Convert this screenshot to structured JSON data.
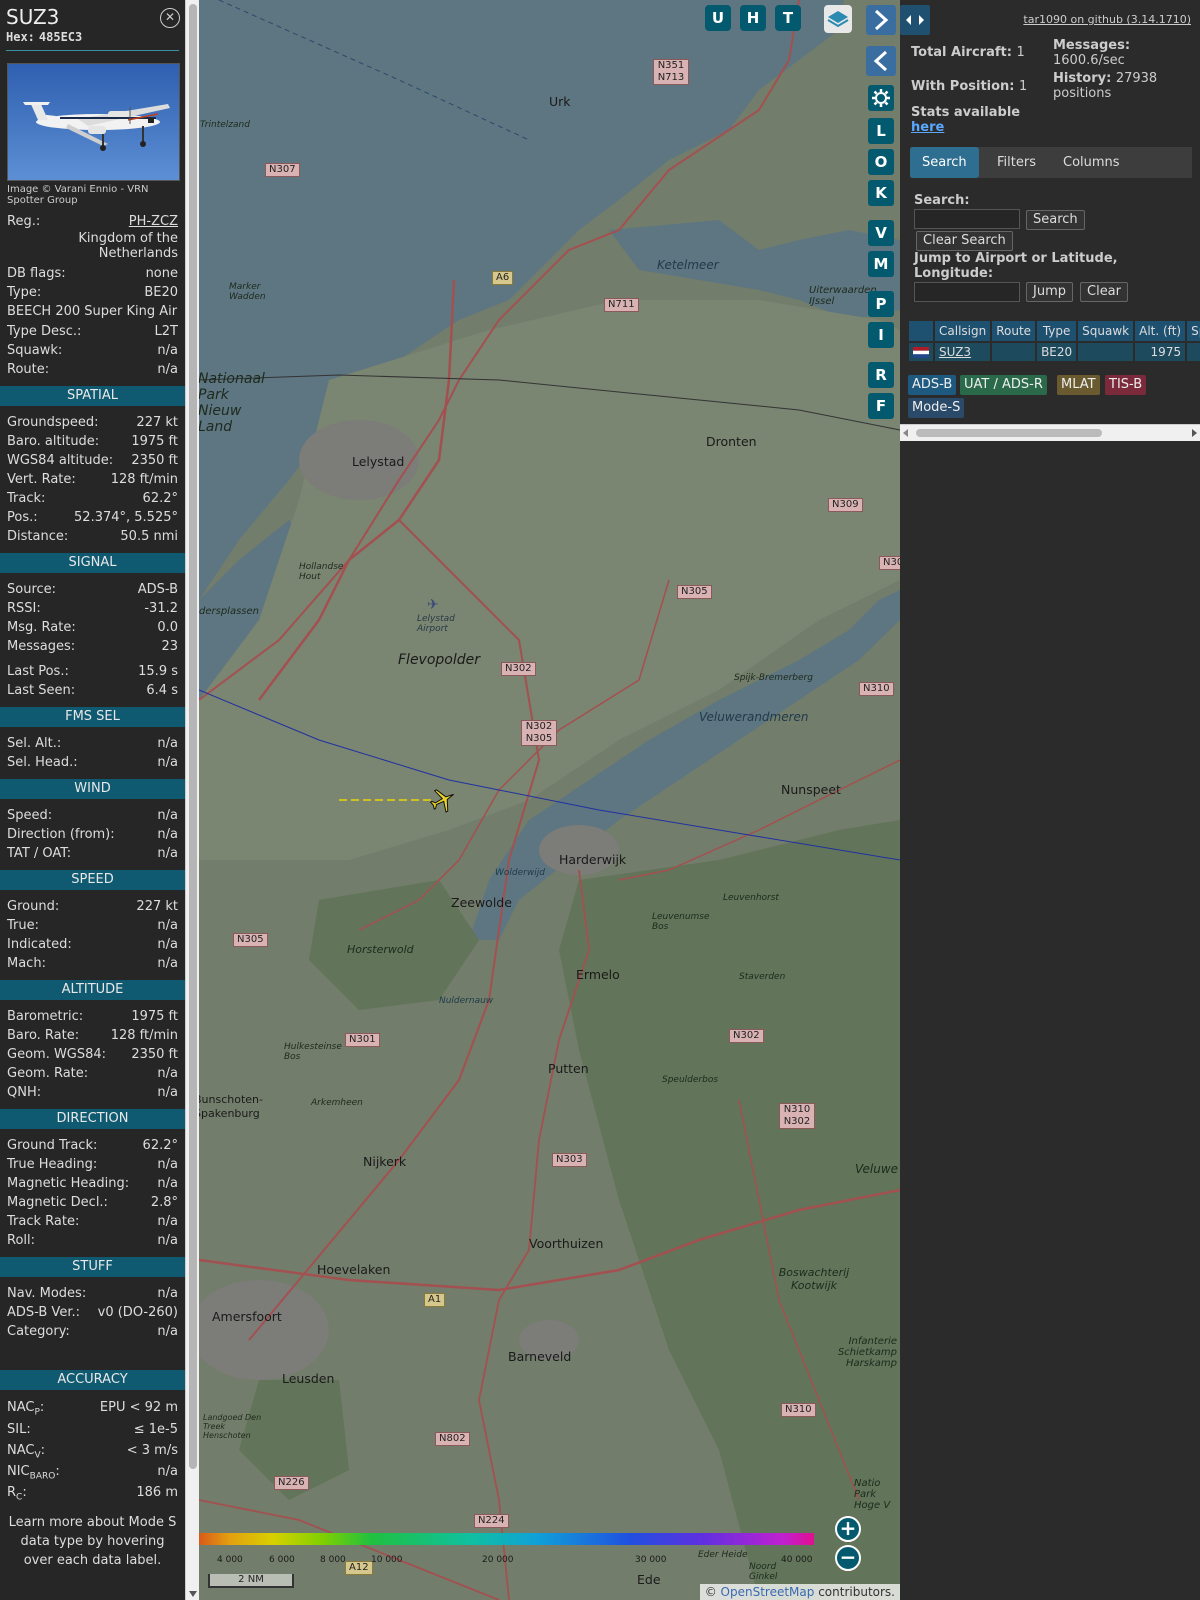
{
  "sidebar": {
    "callsign": "SUZ3",
    "hex_label": "Hex:",
    "hex": "485EC3",
    "photo_credit": "Image © Varani Ennio - VRN Spotter Group",
    "reg_label": "Reg.:",
    "reg": "PH-ZCZ",
    "country": "Kingdom of the Netherlands",
    "dbflags_label": "DB flags:",
    "dbflags": "none",
    "type_label": "Type:",
    "type": "BE20",
    "type_full": "BEECH 200 Super King Air",
    "typedesc_label": "Type Desc.:",
    "typedesc": "L2T",
    "squawk_label": "Squawk:",
    "squawk": "n/a",
    "route_label": "Route:",
    "route": "n/a",
    "sections": {
      "spatial": "SPATIAL",
      "signal": "SIGNAL",
      "fms": "FMS SEL",
      "wind": "WIND",
      "speed": "SPEED",
      "altitude": "ALTITUDE",
      "direction": "DIRECTION",
      "stuff": "STUFF",
      "accuracy": "ACCURACY"
    },
    "spatial": [
      {
        "label": "Groundspeed:",
        "value": "227 kt"
      },
      {
        "label": "Baro. altitude:",
        "value": "1975 ft"
      },
      {
        "label": "WGS84 altitude:",
        "value": "2350 ft"
      },
      {
        "label": "Vert. Rate:",
        "value": "128 ft/min"
      },
      {
        "label": "Track:",
        "value": "62.2°"
      },
      {
        "label": "Pos.:",
        "value": "52.374°, 5.525°"
      },
      {
        "label": "Distance:",
        "value": "50.5 nmi"
      }
    ],
    "signal": [
      {
        "label": "Source:",
        "value": "ADS-B"
      },
      {
        "label": "RSSI:",
        "value": "-31.2"
      },
      {
        "label": "Msg. Rate:",
        "value": "0.0"
      },
      {
        "label": "Messages:",
        "value": "23"
      }
    ],
    "signal2": [
      {
        "label": "Last Pos.:",
        "value": "15.9 s"
      },
      {
        "label": "Last Seen:",
        "value": "6.4 s"
      }
    ],
    "fms": [
      {
        "label": "Sel. Alt.:",
        "value": "n/a"
      },
      {
        "label": "Sel. Head.:",
        "value": "n/a"
      }
    ],
    "wind": [
      {
        "label": "Speed:",
        "value": "n/a"
      },
      {
        "label": "Direction (from):",
        "value": "n/a"
      },
      {
        "label": "TAT / OAT:",
        "value": "n/a"
      }
    ],
    "speed": [
      {
        "label": "Ground:",
        "value": "227 kt"
      },
      {
        "label": "True:",
        "value": "n/a"
      },
      {
        "label": "Indicated:",
        "value": "n/a"
      },
      {
        "label": "Mach:",
        "value": "n/a"
      }
    ],
    "altitude": [
      {
        "label": "Barometric:",
        "value": "1975 ft"
      },
      {
        "label": "Baro. Rate:",
        "value": "128 ft/min"
      },
      {
        "label": "Geom. WGS84:",
        "value": "2350 ft"
      },
      {
        "label": "Geom. Rate:",
        "value": "n/a"
      },
      {
        "label": "QNH:",
        "value": "n/a"
      }
    ],
    "direction": [
      {
        "label": "Ground Track:",
        "value": "62.2°"
      },
      {
        "label": "True Heading:",
        "value": "n/a"
      },
      {
        "label": "Magnetic Heading:",
        "value": "n/a"
      },
      {
        "label": "Magnetic Decl.:",
        "value": "2.8°"
      },
      {
        "label": "Track Rate:",
        "value": "n/a"
      },
      {
        "label": "Roll:",
        "value": "n/a"
      }
    ],
    "stuff": [
      {
        "label": "Nav. Modes:",
        "value": "n/a"
      },
      {
        "label": "ADS-B Ver.:",
        "value": "v0 (DO-260)"
      },
      {
        "label": "Category:",
        "value": "n/a"
      }
    ],
    "accuracy": {
      "nacp_base": "NAC",
      "nacp_sub": "P",
      "nacp_value": "EPU < 92 m",
      "sil_label": "SIL:",
      "sil_value": "≤ 1e-5",
      "nacv_base": "NAC",
      "nacv_sub": "V",
      "nacv_value": "< 3 m/s",
      "nic_base": "NIC",
      "nic_sub": "BARO",
      "nic_value": "n/a",
      "rc_base": "R",
      "rc_sub": "C",
      "rc_value": "186 m"
    },
    "footer": "Learn more about Mode S data type by hovering over each data label."
  },
  "map": {
    "buttons_top": [
      "U",
      "H",
      "T"
    ],
    "buttons_side": [
      "L",
      "O",
      "K",
      "V",
      "M",
      "P",
      "I",
      "R",
      "F"
    ],
    "labels": {
      "urk": "Urk",
      "lelystad": "Lelystad",
      "dronten": "Dronten",
      "flevopolder": "Flevopolder",
      "harderwijk": "Harderwijk",
      "zeewolde": "Zeewolde",
      "ermelo": "Ermelo",
      "putten": "Putten",
      "nijkerk": "Nijkerk",
      "voorthuizen": "Voorthuizen",
      "hoevelaken": "Hoevelaken",
      "amersfoort": "Amersfoort",
      "barneveld": "Barneveld",
      "leusden": "Leusden",
      "ede": "Ede",
      "nunspeet": "Nunspeet",
      "ketelmeer": "Ketelmeer",
      "veluwerandmeren": "Veluwerandmeren",
      "horsterwold": "Horsterwold",
      "markerwadden": "Marker Wadden",
      "trintelzand": "Trintelzand",
      "nationaal": "Nationaal Park Nieuw Land",
      "hollandse": "Hollandse Hout",
      "lelystad_airport": "Lelystad Airport",
      "spijk": "Spijk-Bremerberg",
      "leuvenhorst": "Leuvenhorst",
      "leuvenumse": "Leuvenumse Bos",
      "staverden": "Staverden",
      "speulderbos": "Speulderbos",
      "boswachterij": "Boswachterij Kootwijk",
      "arkemheen": "Arkemheen",
      "bunschoten": "Bunschoten-Spakenburg",
      "hulkesteinse": "Hulkesteinse Bos",
      "uiterwaarden": "Uiterwaarden IJssel",
      "dersplassen": "dersplassen",
      "veluwe": "Veluwe",
      "infanterie": "Infanterie Schietkamp Harskamp",
      "langoed": "Landgoed Den Treek Henschoten",
      "nationaal2": "Natio Park Hoge V",
      "nuldernauw": "Nuldernauw",
      "wolderwijd": "Wolderwijd",
      "eder": "Eder Heide",
      "noord": "Noord Ginkel"
    },
    "roads": [
      "N307",
      "N351 N713",
      "A6",
      "N711",
      "N309",
      "N305",
      "N302",
      "N302 N305",
      "N305",
      "N301",
      "N303",
      "N302",
      "N310 N302",
      "A1",
      "N310",
      "N802",
      "N226",
      "N224",
      "A12",
      "N310",
      "N30"
    ],
    "colorbar_ticks": [
      "4 000",
      "6 000",
      "8 000",
      "10 000",
      "20 000",
      "30 000",
      "40 000"
    ],
    "scale": "2 NM",
    "attribution_prefix": "© ",
    "attribution_link": "OpenStreetMap",
    "attribution_suffix": " contributors."
  },
  "right": {
    "github": "tar1090 on github (3.14.1710)",
    "total_label": "Total Aircraft:",
    "total_value": "1",
    "withpos_label": "With Position:",
    "withpos_value": "1",
    "stats_label": "Stats available",
    "stats_link": "here",
    "messages_label": "Messages:",
    "messages_value": "1600.6/sec",
    "history_label": "History:",
    "history_value": "27938 positions",
    "tabs": [
      "Search",
      "Filters",
      "Columns"
    ],
    "search_label": "Search:",
    "search_btn": "Search",
    "clear_search_btn": "Clear Search",
    "jump_label": "Jump to Airport or Latitude, Longitude:",
    "jump_btn": "Jump",
    "clear_btn": "Clear",
    "table": {
      "headers": [
        "",
        "Callsign",
        "Route",
        "Type",
        "Squawk",
        "Alt. (ft)",
        "Spd."
      ],
      "row": {
        "callsign": "SUZ3",
        "route": "",
        "type": "BE20",
        "squawk": "",
        "alt": "1975",
        "spd": ""
      }
    },
    "legend": [
      {
        "label": "ADS-B",
        "color": "#1e5a80"
      },
      {
        "label": "UAT / ADS-R",
        "color": "#2a6a4a"
      },
      {
        "label": "MLAT",
        "color": "#6a5a30"
      },
      {
        "label": "TIS-B",
        "color": "#7a2a3a"
      },
      {
        "label": "Mode-S",
        "color": "#2a4a6a"
      }
    ]
  }
}
